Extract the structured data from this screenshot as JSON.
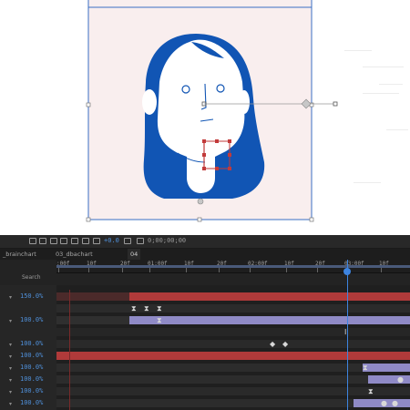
{
  "toolbar": {
    "frame_offset": "+0.0",
    "timecode": "0;00;00;00"
  },
  "tabs": [
    {
      "label": "_brainchart"
    },
    {
      "label": "03_dbachart"
    },
    {
      "label": "04"
    }
  ],
  "timeline": {
    "search_label": "Search",
    "ruler_labels": [
      ":00f",
      "10f",
      "20f",
      "01:00f",
      "10f",
      "20f",
      "02:00f",
      "10f",
      "20f",
      "03:00f",
      "10f"
    ],
    "layers": [
      {
        "arrow": "▾",
        "value": "150.0%"
      },
      {
        "arrow": "",
        "value": ""
      },
      {
        "arrow": "▾",
        "value": "100.0%"
      },
      {
        "arrow": "",
        "value": ""
      },
      {
        "arrow": "▾",
        "value": "100.0%"
      },
      {
        "arrow": "▾",
        "value": "100.0%"
      },
      {
        "arrow": "▾",
        "value": "100.0%"
      },
      {
        "arrow": "▾",
        "value": "100.0%"
      },
      {
        "arrow": "▾",
        "value": "100.0%"
      },
      {
        "arrow": "▾",
        "value": "100.0%"
      }
    ]
  },
  "colors": {
    "face_blue": "#1155b4",
    "bbox_blue": "#2b6bc4",
    "null_red": "#c23a3a",
    "track_red": "#b03a3a",
    "track_purple": "#8f8ac6",
    "playhead": "#3d84e0"
  }
}
